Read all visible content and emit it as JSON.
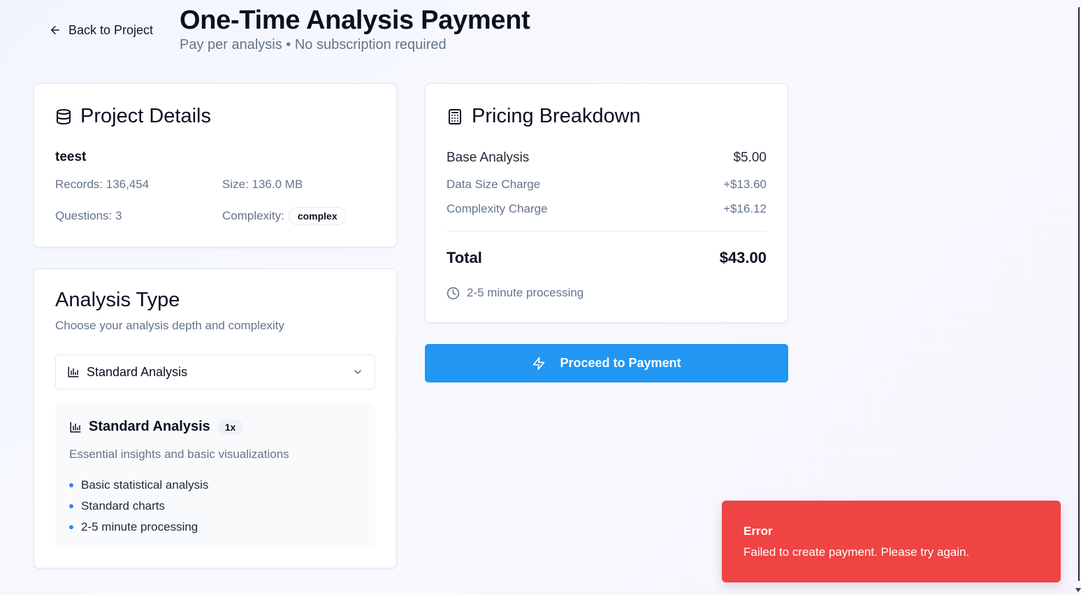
{
  "header": {
    "back_label": "Back to Project",
    "title": "One-Time Analysis Payment",
    "subtitle": "Pay per analysis • No subscription required"
  },
  "project": {
    "title": "Project Details",
    "name": "teest",
    "records": "Records: 136,454",
    "size": "Size: 136.0 MB",
    "questions": "Questions: 3",
    "complexity_label": "Complexity:",
    "complexity_value": "complex"
  },
  "analysis": {
    "title": "Analysis Type",
    "description": "Choose your analysis depth and complexity",
    "selected": "Standard Analysis",
    "info": {
      "name": "Standard Analysis",
      "multiplier": "1x",
      "description": "Essential insights and basic visualizations",
      "features": [
        "Basic statistical analysis",
        "Standard charts",
        "2-5 minute processing"
      ]
    }
  },
  "pricing": {
    "title": "Pricing Breakdown",
    "rows": [
      {
        "label": "Base Analysis",
        "value": "$5.00"
      },
      {
        "label": "Data Size Charge",
        "value": "+$13.60"
      },
      {
        "label": "Complexity Charge",
        "value": "+$16.12"
      }
    ],
    "total_label": "Total",
    "total_value": "$43.00",
    "processing": "2-5 minute processing"
  },
  "payment_button": "Proceed to Payment",
  "toast": {
    "title": "Error",
    "message": "Failed to create payment. Please try again.",
    "color": "#ef4444"
  },
  "colors": {
    "primary": "#2196f3",
    "bullet": "#3b82f6",
    "muted_text": "#64748b"
  },
  "icons": {
    "back": "arrow-left-icon",
    "project": "database-icon",
    "pricing": "calculator-icon",
    "analysis": "bar-chart-icon",
    "select": "chevron-down-icon",
    "processing": "clock-icon",
    "payment": "zap-icon"
  }
}
